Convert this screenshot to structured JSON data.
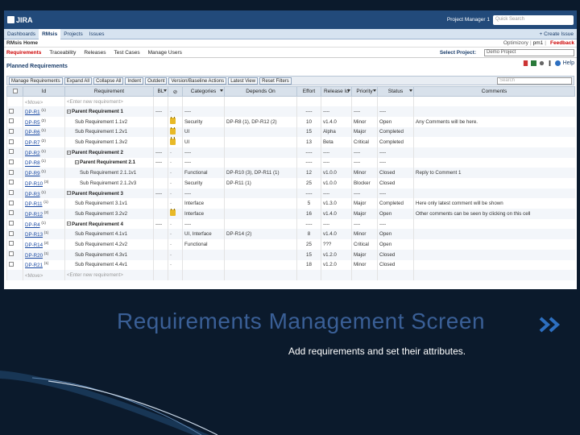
{
  "header": {
    "logo": "JIRA",
    "project_manager": "Project Manager 1",
    "quick_search": "Quick Search"
  },
  "nav": {
    "items": [
      "Dashboards",
      "RMsis",
      "Projects",
      "Issues"
    ],
    "create": "+ Create Issue"
  },
  "home": {
    "title": "RMsis Home",
    "links": [
      "Optimizory",
      "pm1"
    ],
    "feedback": "Feedback"
  },
  "subnav": {
    "items": [
      "Requirements",
      "Traceability",
      "Releases",
      "Test Cases",
      "Manage Users"
    ],
    "select_label": "Select Project:",
    "select_value": "Demo Project"
  },
  "section": {
    "title": "Planned Requirements",
    "help": "Help"
  },
  "toolbar": {
    "buttons": [
      "Manage Requirements",
      "Expand All",
      "Collapse All",
      "Indent",
      "Outdent",
      "Version/Baseline Actions",
      "Latest View",
      "Reset Filters"
    ],
    "search": "Search"
  },
  "columns": [
    "Id",
    "Requirement",
    "BL",
    "Categories",
    "Depends On",
    "Effort",
    "Release Id",
    "Priority",
    "Status",
    "Comments"
  ],
  "rows": [
    {
      "id": "<Move>",
      "sup": "",
      "req": "<Enter new requirement>",
      "type": "new",
      "bl": "",
      "lock": false,
      "cat": "",
      "dep": "",
      "effort": "",
      "rel": "",
      "pri": "",
      "status": "",
      "comment": ""
    },
    {
      "id": "DP-R1",
      "sup": "(1)",
      "req": "Parent Requirement 1",
      "type": "parent",
      "bl": "----",
      "lock": false,
      "cat": "----",
      "dep": "",
      "effort": "----",
      "rel": "----",
      "pri": "----",
      "status": "----",
      "comment": ""
    },
    {
      "id": "DP-R5",
      "sup": "(2)",
      "req": "Sub Requirement 1.1v2",
      "type": "sub",
      "bl": "",
      "lock": true,
      "cat": "Security",
      "dep": "DP-R8 (1), DP-R12 (2)",
      "effort": "10",
      "rel": "v1.4.0",
      "pri": "Minor",
      "status": "Open",
      "comment": "Any Comments will be here."
    },
    {
      "id": "DP-R6",
      "sup": "(1)",
      "req": "Sub Requirement 1.2v1",
      "type": "sub",
      "bl": "",
      "lock": true,
      "cat": "UI",
      "dep": "",
      "effort": "15",
      "rel": "Alpha",
      "pri": "Major",
      "status": "Completed",
      "comment": ""
    },
    {
      "id": "DP-R7",
      "sup": "(2)",
      "req": "Sub Requirement 1.3v2",
      "type": "sub",
      "bl": "",
      "lock": true,
      "cat": "UI",
      "dep": "",
      "effort": "13",
      "rel": "Beta",
      "pri": "Critical",
      "status": "Completed",
      "comment": ""
    },
    {
      "id": "DP-R2",
      "sup": "(1)",
      "req": "Parent Requirement 2",
      "type": "parent",
      "bl": "----",
      "lock": false,
      "cat": "----",
      "dep": "",
      "effort": "----",
      "rel": "----",
      "pri": "----",
      "status": "----",
      "comment": ""
    },
    {
      "id": "DP-R8",
      "sup": "(1)",
      "req": "Parent Requirement 2.1",
      "type": "parent2",
      "bl": "----",
      "lock": false,
      "cat": "----",
      "dep": "",
      "effort": "----",
      "rel": "----",
      "pri": "----",
      "status": "----",
      "comment": ""
    },
    {
      "id": "DP-R9",
      "sup": "(1)",
      "req": "Sub Requirement 2.1.1v1",
      "type": "sub2",
      "bl": "",
      "lock": false,
      "cat": "Functional",
      "dep": "DP-R10 (3), DP-R11 (1)",
      "effort": "12",
      "rel": "v1.0.0",
      "pri": "Minor",
      "status": "Closed",
      "comment": "Reply to Comment 1"
    },
    {
      "id": "DP-R10",
      "sup": "(3)",
      "req": "Sub Requirement 2.1.2v3",
      "type": "sub2",
      "bl": "",
      "lock": false,
      "cat": "Security",
      "dep": "DP-R11 (1)",
      "effort": "25",
      "rel": "v1.0.0",
      "pri": "Blocker",
      "status": "Closed",
      "comment": ""
    },
    {
      "id": "DP-R3",
      "sup": "(1)",
      "req": "Parent Requirement 3",
      "type": "parent",
      "bl": "----",
      "lock": false,
      "cat": "----",
      "dep": "",
      "effort": "----",
      "rel": "----",
      "pri": "----",
      "status": "----",
      "comment": ""
    },
    {
      "id": "DP-R11",
      "sup": "(1)",
      "req": "Sub Requirement 3.1v1",
      "type": "sub",
      "bl": "",
      "lock": false,
      "cat": "Interface",
      "dep": "",
      "effort": "5",
      "rel": "v1.3.0",
      "pri": "Major",
      "status": "Completed",
      "comment": "Here only latest comment will be shown"
    },
    {
      "id": "DP-R12",
      "sup": "(2)",
      "req": "Sub Requirement 3.2v2",
      "type": "sub",
      "bl": "",
      "lock": true,
      "cat": "Interface",
      "dep": "",
      "effort": "16",
      "rel": "v1.4.0",
      "pri": "Major",
      "status": "Open",
      "comment": "Other comments can be seen by clicking on this cell"
    },
    {
      "id": "DP-R4",
      "sup": "(1)",
      "req": "Parent Requirement 4",
      "type": "parent",
      "bl": "----",
      "lock": false,
      "cat": "----",
      "dep": "",
      "effort": "----",
      "rel": "----",
      "pri": "----",
      "status": "----",
      "comment": ""
    },
    {
      "id": "DP-R13",
      "sup": "(1)",
      "req": "Sub Requirement 4.1v1",
      "type": "sub",
      "bl": "",
      "lock": false,
      "cat": "UI, Interface",
      "dep": "DP-R14 (2)",
      "effort": "8",
      "rel": "v1.4.0",
      "pri": "Minor",
      "status": "Open",
      "comment": ""
    },
    {
      "id": "DP-R14",
      "sup": "(2)",
      "req": "Sub Requirement 4.2v2",
      "type": "sub",
      "bl": "",
      "lock": false,
      "cat": "Functional",
      "dep": "",
      "effort": "25",
      "rel": "???",
      "pri": "Critical",
      "status": "Open",
      "comment": ""
    },
    {
      "id": "DP-R20",
      "sup": "(1)",
      "req": "Sub Requirement 4.3v1",
      "type": "sub",
      "bl": "",
      "lock": false,
      "cat": "",
      "dep": "",
      "effort": "15",
      "rel": "v1.2.0",
      "pri": "Major",
      "status": "Closed",
      "comment": ""
    },
    {
      "id": "DP-R21",
      "sup": "(1)",
      "req": "Sub Requirement 4.4v1",
      "type": "sub",
      "bl": "",
      "lock": false,
      "cat": "",
      "dep": "",
      "effort": "18",
      "rel": "v1.2.0",
      "pri": "Minor",
      "status": "Closed",
      "comment": ""
    },
    {
      "id": "<Move>",
      "sup": "",
      "req": "<Enter new requirement>",
      "type": "new",
      "bl": "",
      "lock": false,
      "cat": "",
      "dep": "",
      "effort": "",
      "rel": "",
      "pri": "",
      "status": "",
      "comment": ""
    }
  ],
  "slide": {
    "title": "Requirements Management Screen",
    "subtitle": "Add requirements and set their attributes."
  },
  "colors": {
    "jira_bar": "#224a7a",
    "accent_red": "#cc0000",
    "slide_title": "#3a5f96",
    "background": "#0b1a2c"
  }
}
